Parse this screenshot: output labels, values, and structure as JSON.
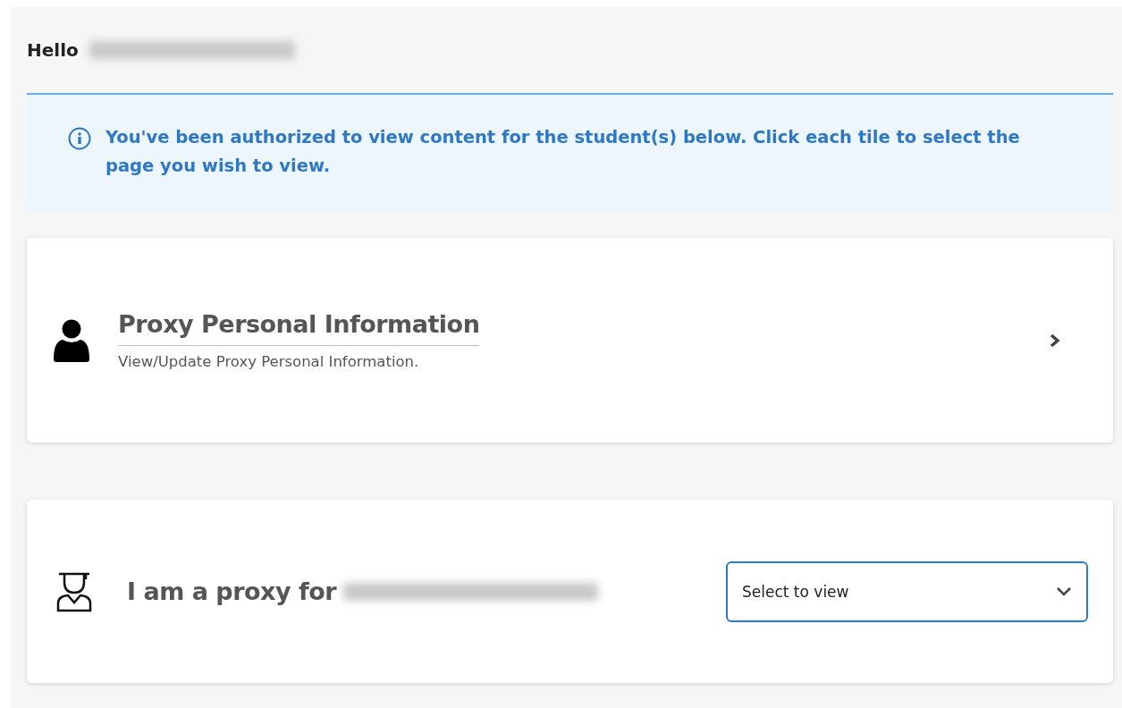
{
  "greeting": {
    "label": "Hello"
  },
  "notice": {
    "text": "You've been authorized to view content for the student(s) below. Click each tile to select the page you wish to view."
  },
  "tiles": [
    {
      "kind": "link",
      "title": "Proxy Personal Information",
      "subtitle": "View/Update Proxy Personal Information."
    },
    {
      "kind": "select",
      "title": "I am a proxy for",
      "placeholder": "Select to view"
    }
  ]
}
